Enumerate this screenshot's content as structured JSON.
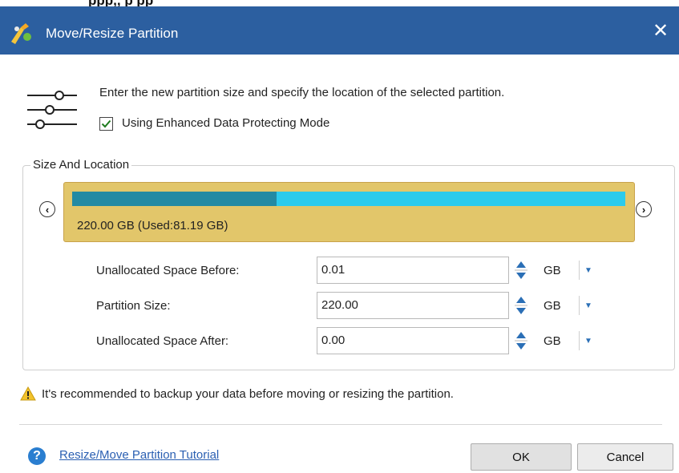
{
  "window": {
    "top_fragment": "ppp,, p pp",
    "title": "Move/Resize Partition",
    "close_glyph": "✕"
  },
  "intro": {
    "description": "Enter the new partition size and specify the location of the selected partition.",
    "checkbox_label": "Using Enhanced Data Protecting Mode",
    "checkbox_checked": true
  },
  "size_location": {
    "legend": "Size And Location",
    "partition_label": "220.00 GB (Used:81.19 GB)",
    "used_fraction": 0.369,
    "colors": {
      "used": "#238aa3",
      "free": "#2ccbec",
      "partition_bg": "#e2c66a"
    },
    "nav_left": "‹",
    "nav_right": "›"
  },
  "fields": [
    {
      "label": "Unallocated Space Before:",
      "value": "0.01",
      "unit": "GB"
    },
    {
      "label": "Partition Size:",
      "value": "220.00",
      "unit": "GB"
    },
    {
      "label": "Unallocated Space After:",
      "value": "0.00",
      "unit": "GB"
    }
  ],
  "warning": {
    "text": "It's recommended to backup your data before moving or resizing the partition."
  },
  "footer": {
    "help_icon": "?",
    "help_link": "Resize/Move Partition Tutorial",
    "ok_label": "OK",
    "cancel_label": "Cancel"
  },
  "icons": {
    "app": "partition-wizard-icon",
    "sliders": "sliders-icon",
    "warning": "warning-icon",
    "help": "help-icon"
  }
}
